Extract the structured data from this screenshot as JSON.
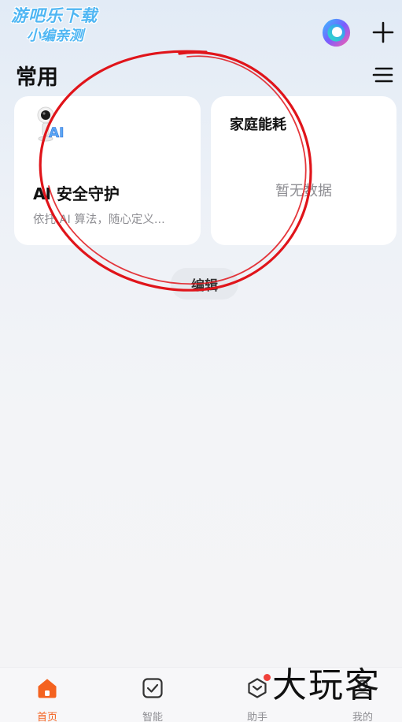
{
  "watermark": {
    "line1": "游吧乐下载",
    "line2": "小编亲测"
  },
  "header": {
    "section_title": "常用"
  },
  "cards": {
    "ai_security": {
      "title": "AI 安全守护",
      "subtitle": "依托 AI 算法，随心定义..."
    },
    "energy": {
      "title": "家庭能耗",
      "empty": "暂无数据"
    }
  },
  "edit_label": "编辑",
  "bottom_nav": {
    "items": [
      {
        "label": "首页",
        "icon": "home-icon",
        "active": true
      },
      {
        "label": "智能",
        "icon": "smart-checkbox-icon",
        "active": false
      },
      {
        "label": "助手",
        "icon": "assistant-icon",
        "active": false
      },
      {
        "label": "我的",
        "icon": "profile-icon",
        "active": false
      }
    ]
  },
  "bottom_watermark": "大玩客",
  "colors": {
    "accent": "#f4621f",
    "annotation": "#e0141a",
    "badge": "#f0413b",
    "watermark": "#4fb6f3"
  }
}
